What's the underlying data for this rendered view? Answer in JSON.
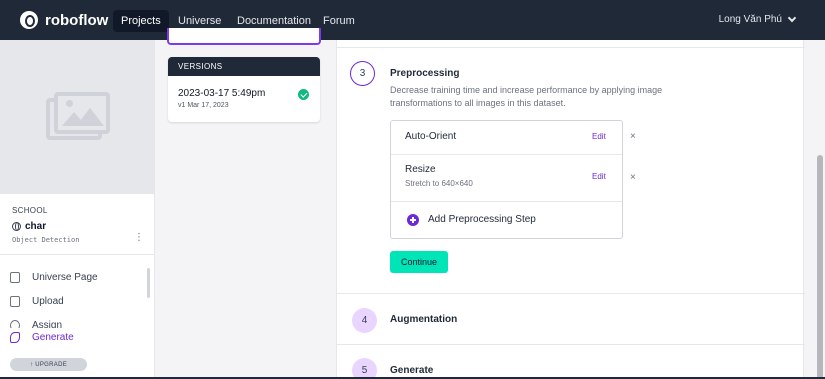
{
  "brand": {
    "name": "roboflow"
  },
  "nav": {
    "links": [
      "Projects",
      "Universe",
      "Documentation",
      "Forum"
    ],
    "active": "Projects",
    "user": "Long Văn Phú"
  },
  "sidebar": {
    "workspace": "SCHOOL",
    "project_name": "char",
    "project_type": "Object Detection",
    "items": [
      {
        "label": "Universe Page",
        "icon": "universe-page-icon"
      },
      {
        "label": "Upload",
        "icon": "upload-icon"
      },
      {
        "label": "Assign",
        "icon": "assign-icon"
      },
      {
        "label": "Generate",
        "icon": "generate-icon",
        "active": true
      }
    ],
    "upgrade_label": "↑ UPGRADE"
  },
  "versions": {
    "header": "VERSIONS",
    "items": [
      {
        "name": "2023-03-17 5:49pm",
        "sub": "v1 Mar 17, 2023",
        "status": "complete"
      }
    ]
  },
  "steps": {
    "current": {
      "number": "3",
      "title": "Preprocessing",
      "description": "Decrease training time and increase performance by applying image transformations to all images in this dataset.",
      "rows": [
        {
          "title": "Auto-Orient",
          "sub": "",
          "edit": "Edit",
          "remove": "×"
        },
        {
          "title": "Resize",
          "sub": "Stretch to 640×640",
          "edit": "Edit",
          "remove": "×"
        }
      ],
      "add_label": "Add Preprocessing Step",
      "continue_label": "Continue"
    },
    "next": [
      {
        "number": "4",
        "title": "Augmentation"
      },
      {
        "number": "5",
        "title": "Generate"
      }
    ]
  },
  "colors": {
    "nav_bg": "#1f2937",
    "accent": "#6d28d9",
    "continue": "#00e5b8",
    "success": "#10b981"
  }
}
